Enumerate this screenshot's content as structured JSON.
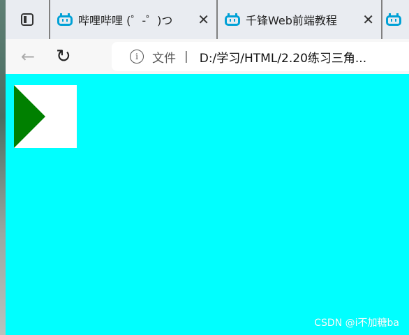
{
  "tabs": [
    {
      "title": "哔哩哔哩 (゜-゜)つ",
      "icon": "bilibili-tv-icon",
      "close_label": "✕"
    },
    {
      "title": "千锋Web前端教程",
      "icon": "bilibili-tv-icon",
      "close_label": "✕"
    },
    {
      "title": "",
      "icon": "bilibili-tv-icon"
    }
  ],
  "address_bar": {
    "back_label": "←",
    "refresh_label": "↻",
    "info_label": "i",
    "scheme_label": "文件",
    "separator": "|",
    "url": "D:/学习/HTML/2.20练习三角..."
  },
  "page": {
    "background": "#00ffff",
    "box_color": "#ffffff",
    "triangle_color": "#008000"
  },
  "watermark": "CSDN @i不加糖ba"
}
